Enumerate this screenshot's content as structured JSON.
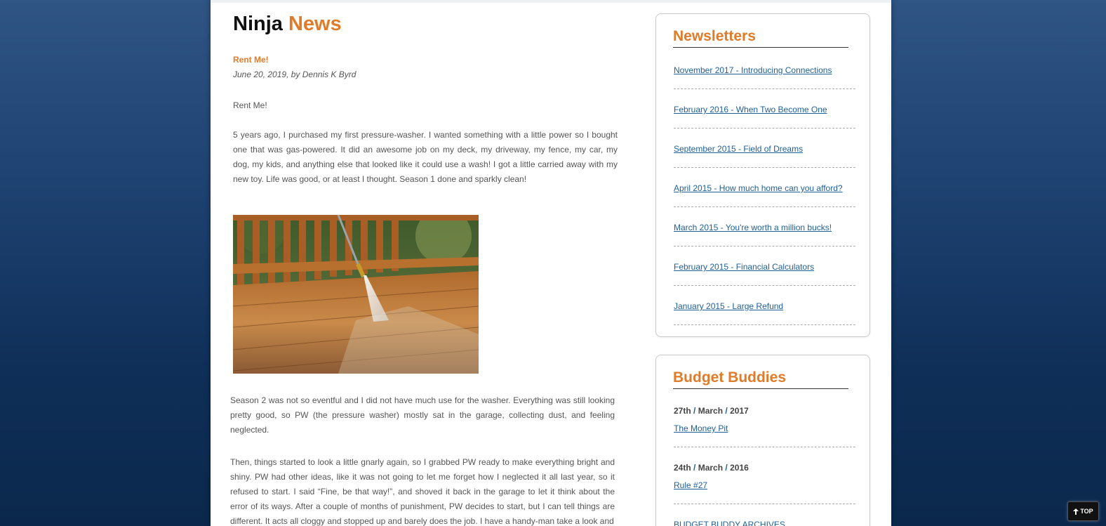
{
  "header": {
    "title_part1": "Ninja",
    "title_part2": "News"
  },
  "post": {
    "title": "Rent Me!",
    "meta": "June 20, 2019, by Dennis K Byrd",
    "paragraphs": [
      "Rent Me!",
      "5 years ago, I purchased my first pressure-washer. I wanted something with a little power so I bought one that was gas-powered. It did an awesome job on my deck, my driveway, my fence, my car, my dog, my kids, and anything else that looked like it could use a wash! I got a little carried away with my new toy. Life was good, or at least I thought. Season 1 done and sparkly clean!",
      "Season 2 was not so eventful and I did not have much use for the washer. Everything was still looking pretty good, so PW (the pressure washer) mostly sat in the garage, collecting dust, and feeling neglected.",
      "Then, things started to look a little gnarly again, so I grabbed PW ready to make everything bright and shiny. PW had other ideas, like it was not going to let me forget how I neglected it all last year, so it refused to start. I said “Fine, be that way!”, and shoved it back in the garage to let it think about the error of its ways. After a couple of months of punishment, PW decides to start, but I can tell things are different. It acts all cloggy and stopped up and barely does the job. I have a handy-man take a look and"
    ]
  },
  "sidebar": {
    "newsletters": {
      "heading": "Newsletters",
      "items": [
        "November 2017 - Introducing Connections",
        "February 2016 - When Two Become One",
        "September 2015 - Field of Dreams",
        "April 2015 - How much home can you afford?",
        "March 2015 - You're worth a million bucks!",
        "February 2015 - Financial Calculators",
        "January 2015 - Large Refund"
      ]
    },
    "budget_buddies": {
      "heading": "Budget Buddies",
      "entries": [
        {
          "day": "27th",
          "month": "March",
          "year": "2017",
          "title": "The Money Pit"
        },
        {
          "day": "24th",
          "month": "March",
          "year": "2016",
          "title": "Rule #27"
        }
      ],
      "sep": "/",
      "archives": "BUDGET BUDDY ARCHIVES"
    }
  },
  "top_button": {
    "label": "TOP",
    "icon": "arrow-up-icon"
  },
  "colors": {
    "accent": "#e07b2a",
    "link": "#1f5f96",
    "bg_top": "#2f5585",
    "bg_bottom": "#0b284c"
  }
}
